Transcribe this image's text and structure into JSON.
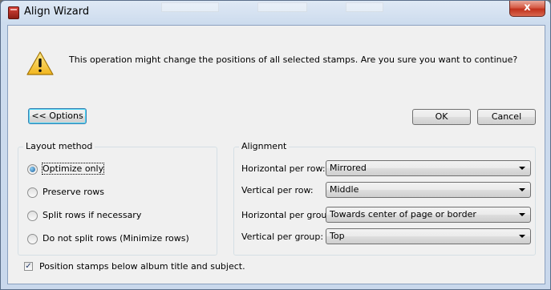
{
  "window": {
    "title": "Align Wizard",
    "close_glyph": "x"
  },
  "message": "This operation might change the positions of all selected stamps. Are you sure you want to continue?",
  "buttons": {
    "options_label": "<< Options",
    "ok_label": "OK",
    "cancel_label": "Cancel"
  },
  "layout_method": {
    "title": "Layout method",
    "options": [
      {
        "label": "Optimize only",
        "checked": true
      },
      {
        "label": "Preserve rows",
        "checked": false
      },
      {
        "label": "Split rows if necessary",
        "checked": false
      },
      {
        "label": "Do not split rows (Minimize rows)",
        "checked": false
      }
    ]
  },
  "alignment": {
    "title": "Alignment",
    "fields": [
      {
        "label": "Horizontal per row:",
        "value": "Mirrored"
      },
      {
        "label": "Vertical per row:",
        "value": "Middle"
      },
      {
        "label": "Horizontal per group:",
        "value": "Towards center of page or border"
      },
      {
        "label": "Vertical per group:",
        "value": "Top"
      }
    ]
  },
  "position_checkbox": {
    "label": "Position stamps below album title and subject.",
    "checked": true
  },
  "icons": {
    "app": "album-app-icon",
    "warning": "warning-triangle-icon",
    "dropdown": "chevron-down-icon"
  },
  "colors": {
    "close_button": "#c0311c",
    "focus_border": "#48d7f6",
    "dialog_background": "#f0f0f0"
  }
}
